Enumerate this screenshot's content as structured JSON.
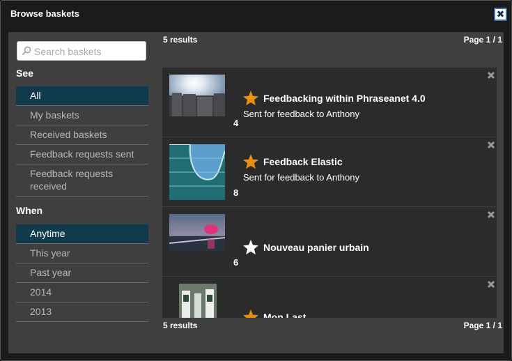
{
  "dialog": {
    "title": "Browse baskets",
    "close_label": "✖"
  },
  "search": {
    "placeholder": "Search baskets"
  },
  "see": {
    "title": "See",
    "items": [
      {
        "label": "All",
        "active": true
      },
      {
        "label": "My baskets"
      },
      {
        "label": "Received baskets"
      },
      {
        "label": "Feedback requests sent"
      },
      {
        "label": "Feedback requests received"
      }
    ]
  },
  "when": {
    "title": "When",
    "items": [
      {
        "label": "Anytime",
        "active": true
      },
      {
        "label": "This year"
      },
      {
        "label": "Past year"
      },
      {
        "label": "2014"
      },
      {
        "label": "2013"
      }
    ]
  },
  "results": {
    "count_label": "5 results",
    "page_label": "Page 1 / 1"
  },
  "baskets": [
    {
      "name": "Feedbacking within Phraseanet 4.0",
      "subtitle": "Sent for feedback to Anthony",
      "count": "4",
      "starred": true
    },
    {
      "name": "Feedback Elastic",
      "subtitle": "Sent for feedback to Anthony",
      "count": "8",
      "starred": true
    },
    {
      "name": "Nouveau panier urbain",
      "subtitle": "",
      "count": "6",
      "starred": false
    },
    {
      "name": "Mon Last",
      "subtitle": "",
      "count": "",
      "starred": true
    }
  ],
  "colors": {
    "star_on": "#e8900f",
    "star_off": "#ffffff",
    "active_filter": "#0f3b4c"
  }
}
